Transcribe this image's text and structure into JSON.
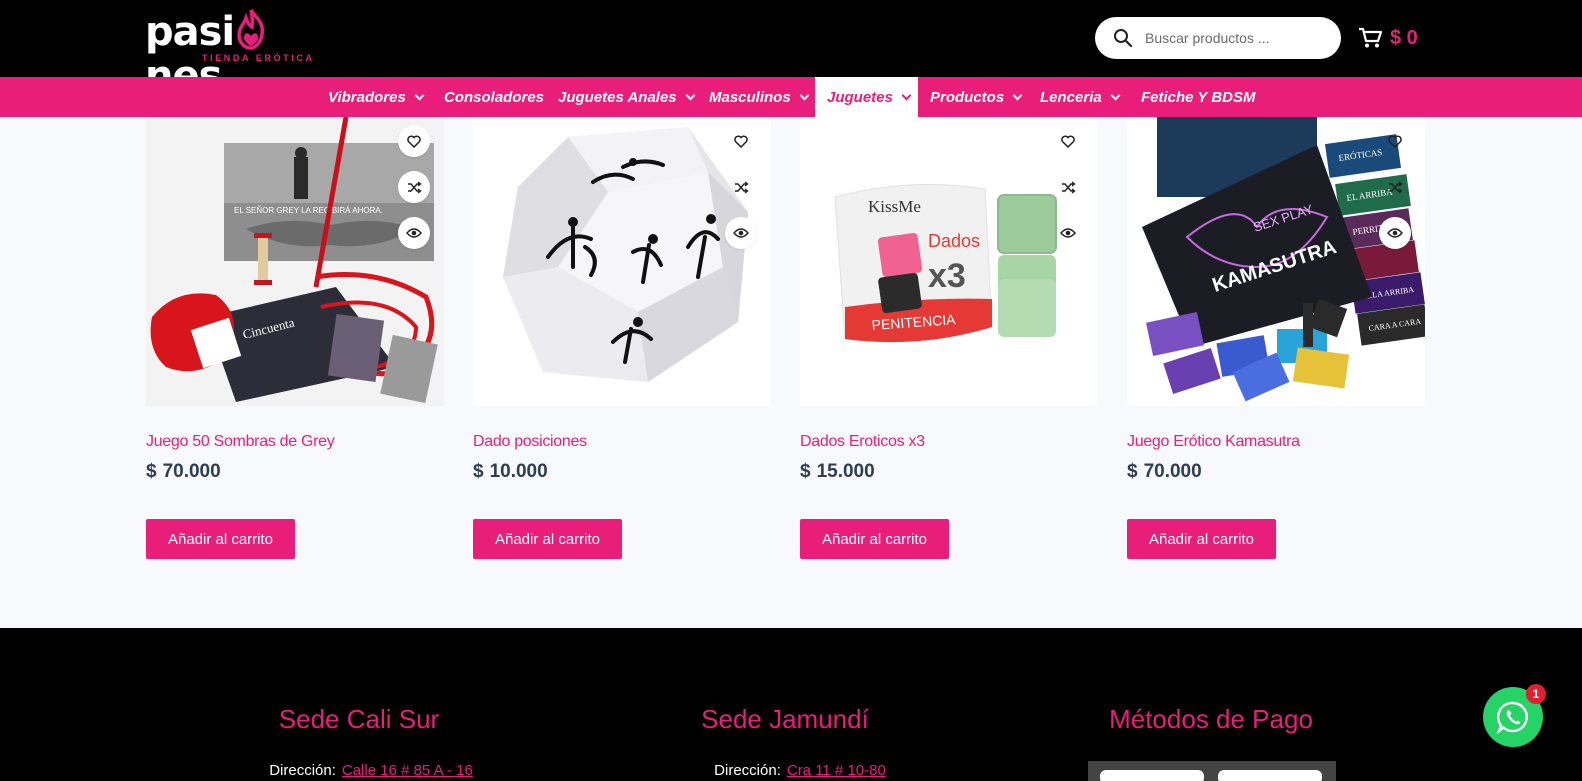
{
  "header": {
    "logo_text": "pasiones",
    "logo_tagline": "TIENDA ERÓTICA",
    "search_placeholder": "Buscar productos ...",
    "cart_total": "$ 0"
  },
  "nav": {
    "items": [
      {
        "label": "Vibradores",
        "has_dropdown": true,
        "active": false
      },
      {
        "label": "Consoladores",
        "has_dropdown": false,
        "active": false
      },
      {
        "label": "Juguetes Anales",
        "has_dropdown": true,
        "active": false
      },
      {
        "label": "Masculinos",
        "has_dropdown": true,
        "active": false
      },
      {
        "label": "Juguetes",
        "has_dropdown": true,
        "active": true
      },
      {
        "label": "Productos",
        "has_dropdown": true,
        "active": false
      },
      {
        "label": "Lenceria",
        "has_dropdown": true,
        "active": false
      },
      {
        "label": "Fetiche Y BDSM",
        "has_dropdown": false,
        "active": false
      }
    ]
  },
  "products": [
    {
      "name": "Juego 50 Sombras de Grey",
      "currency": "$",
      "price": "70.000",
      "button": "Añadir al carrito",
      "image": "fifty-shades-game-image"
    },
    {
      "name": "Dado posiciones",
      "currency": "$",
      "price": "10.000",
      "button": "Añadir al carrito",
      "image": "position-dice-image"
    },
    {
      "name": "Dados Eroticos x3",
      "currency": "$",
      "price": "15.000",
      "button": "Añadir al carrito",
      "image": "erotic-dice-x3-image"
    },
    {
      "name": "Juego Erótico Kamasutra",
      "currency": "$",
      "price": "70.000",
      "button": "Añadir al carrito",
      "image": "kamasutra-game-image"
    }
  ],
  "product_images_text": {
    "p1_box": "EL SEÑOR GREY LA RECIBIRÁ AHORA.",
    "p1_board": "Cincuenta",
    "p3_brand": "KissMe",
    "p3_box_title": "Dados",
    "p3_box_count": "x3",
    "p3_box_band": "PENITENCIA",
    "p4_logo_top": "SEX PLAY",
    "p4_logo_main": "KAMASUTRA",
    "p4_card1": "ERÓTICAS",
    "p4_card2": "EL ARRIBA",
    "p4_card3": "PERRITO",
    "p4_card4": "ELLA ARRIBA",
    "p4_card5": "CARA A CARA"
  },
  "footer": {
    "columns": [
      {
        "title": "Sede Cali Sur",
        "label": "Dirección:",
        "value": "Calle 16 # 85 A - 16"
      },
      {
        "title": "Sede Jamundí",
        "label": "Dirección:",
        "value": "Cra 11 # 10-80"
      },
      {
        "title": "Métodos de Pago"
      }
    ]
  },
  "whatsapp": {
    "badge": "1"
  },
  "colors": {
    "brand": "#e91e7a",
    "header_bg": "#000000",
    "whatsapp": "#25d366"
  }
}
